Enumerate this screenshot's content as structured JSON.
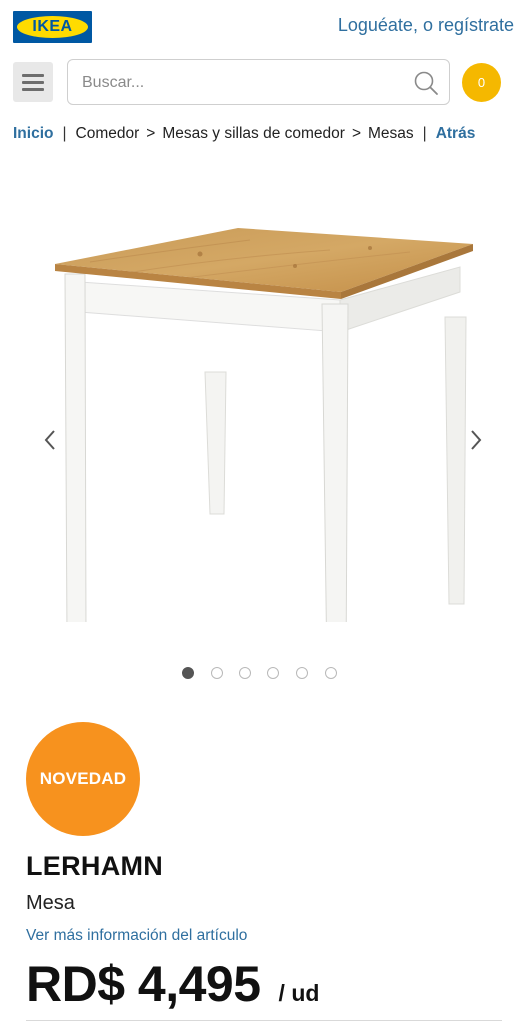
{
  "header": {
    "logo_text": "IKEA",
    "auth_login": "Loguéate",
    "auth_sep": ", o ",
    "auth_register": "regístrate"
  },
  "search": {
    "placeholder": "Buscar..."
  },
  "cart": {
    "count": "0"
  },
  "breadcrumb": {
    "home": "Inicio",
    "separator": "|",
    "items": [
      "Comedor",
      "Mesas y sillas de comedor",
      "Mesas"
    ],
    "arrow": ">",
    "back": "Atrás"
  },
  "carousel": {
    "prev_icon": "chevron-left-icon",
    "next_icon": "chevron-right-icon",
    "slide_count": 6,
    "active_slide": 1
  },
  "product": {
    "badge": "NOVEDAD",
    "name": "LERHAMN",
    "type": "Mesa",
    "more_info": "Ver más información del artículo",
    "price": "RD$ 4,495",
    "unit": "/ ud"
  },
  "colors": {
    "ikea_blue": "#0058a3",
    "ikea_yellow": "#ffdb00",
    "link_blue": "#2f6f9f",
    "cart_yellow": "#f5b800",
    "badge_orange": "#f7921e"
  }
}
